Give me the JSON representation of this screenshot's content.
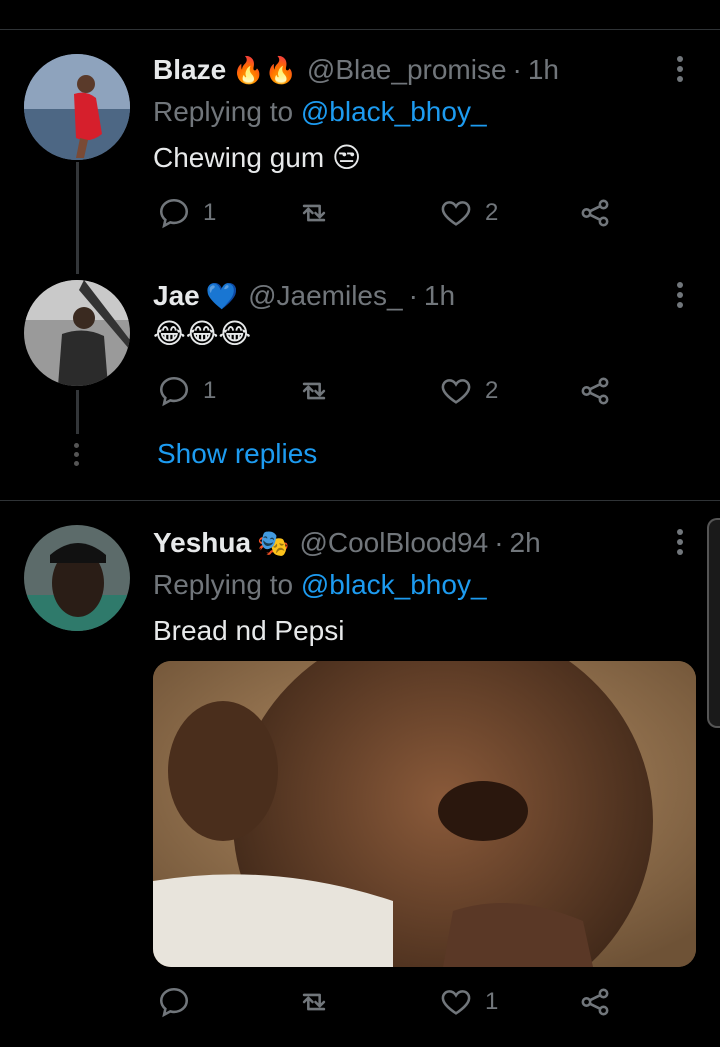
{
  "tweets": [
    {
      "name": "Blaze",
      "badges": "🔥🔥",
      "handle": "@Blae_promise",
      "time": "1h",
      "replying_label": "Replying to",
      "replying_to": "@black_bhoy_",
      "text": "Chewing gum 😒",
      "replies": "1",
      "retweets": "",
      "likes": "2"
    },
    {
      "name": "Jae",
      "badges": "💙",
      "handle": "@Jaemiles_",
      "time": "1h",
      "text": "😂😂😂",
      "replies": "1",
      "retweets": "",
      "likes": "2",
      "show_replies": "Show replies"
    },
    {
      "name": "Yeshua",
      "badges": "🎭",
      "handle": "@CoolBlood94",
      "time": "2h",
      "replying_label": "Replying to",
      "replying_to": "@black_bhoy_",
      "text": "Bread nd Pepsi",
      "replies": "",
      "retweets": "",
      "likes": "1"
    }
  ],
  "colors": {
    "background": "#000000",
    "link": "#1d9bf0",
    "muted": "#71767b"
  }
}
